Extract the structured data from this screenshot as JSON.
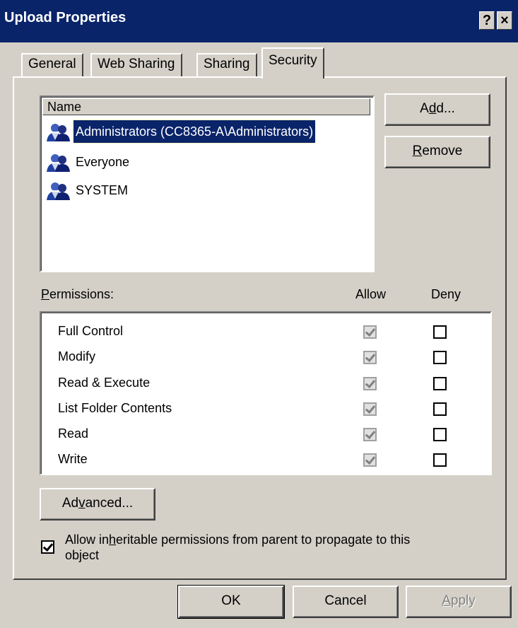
{
  "window": {
    "title": "Upload Properties",
    "help_button": "?",
    "close_button": "×"
  },
  "tabs": [
    {
      "label": "General",
      "active": false
    },
    {
      "label": "Web Sharing",
      "active": false
    },
    {
      "label": "Sharing",
      "active": false
    },
    {
      "label": "Security",
      "active": true
    }
  ],
  "users": {
    "column_header": "Name",
    "items": [
      {
        "label": "Administrators (CC8365-A\\Administrators)",
        "selected": true,
        "icon": "group-icon"
      },
      {
        "label": "Everyone",
        "selected": false,
        "icon": "group-icon"
      },
      {
        "label": "SYSTEM",
        "selected": false,
        "icon": "group-icon"
      }
    ],
    "add_button": {
      "pre": "A",
      "accel": "d",
      "post": "d..."
    },
    "remove_button": {
      "pre": "",
      "accel": "R",
      "post": "emove"
    }
  },
  "permissions": {
    "label": {
      "pre": "",
      "accel": "P",
      "post": "ermissions:"
    },
    "allow_header": "Allow",
    "deny_header": "Deny",
    "rows": [
      {
        "name": "Full Control",
        "allow": true,
        "deny": false
      },
      {
        "name": "Modify",
        "allow": true,
        "deny": false
      },
      {
        "name": "Read & Execute",
        "allow": true,
        "deny": false
      },
      {
        "name": "List Folder Contents",
        "allow": true,
        "deny": false
      },
      {
        "name": "Read",
        "allow": true,
        "deny": false
      },
      {
        "name": "Write",
        "allow": true,
        "deny": false
      }
    ]
  },
  "advanced_button": {
    "pre": "Ad",
    "accel": "v",
    "post": "anced..."
  },
  "inherit": {
    "checked": true,
    "line1_pre": "Allow in",
    "line1_accel": "h",
    "line1_post": "eritable permissions from parent to propagate to this",
    "line2": "object"
  },
  "footer": {
    "ok": "OK",
    "cancel": "Cancel",
    "apply_accel": "A",
    "apply_rest": "pply"
  },
  "colors": {
    "face": "#d4d0c8",
    "titlebar": "#0a246a",
    "selection": "#0a246a"
  }
}
